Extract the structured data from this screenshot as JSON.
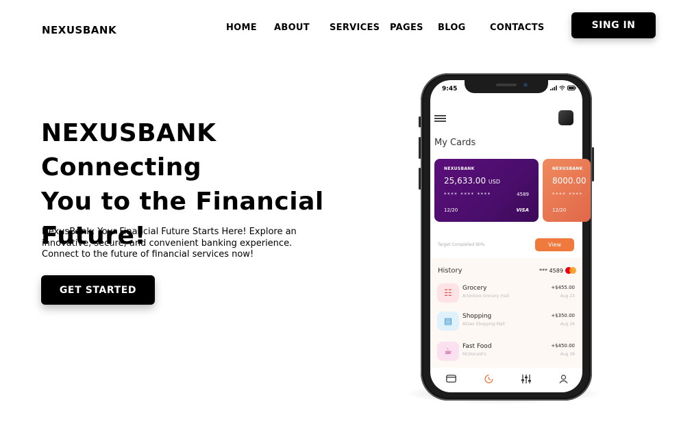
{
  "header": {
    "logo": "NEXUSBANK",
    "nav": [
      "HOME",
      "ABOUT",
      "SERVICES",
      "PAGES",
      "BLOG",
      "CONTACTS"
    ],
    "signin_label": "SING IN"
  },
  "hero": {
    "title_line1": "NEXUSBANK Connecting",
    "title_line2": "You to the Financial",
    "title_line3": "Future!",
    "text_line1": "NexusBank: Your Financial Future Starts Here! Explore an",
    "text_line2": "innovative, secure, and convenient banking experience.",
    "text_line3": "Connect to the future of financial services now!",
    "cta_label": "GET STARTED"
  },
  "phone": {
    "time": "9:45",
    "my_cards_label": "My Cards",
    "cards": [
      {
        "brand": "NEXUSBANK",
        "amount": "25,633.00",
        "currency": "USD",
        "dots": "**** **** ****",
        "last4": "4589",
        "exp": "12/20",
        "network": "VISA"
      },
      {
        "brand": "NEXUSBANK",
        "amount": "8000.00",
        "dots": "**** ****",
        "exp": "12/20"
      }
    ],
    "target_label": "Target Completed 90%",
    "view_label": "View",
    "history_label": "History",
    "history_card": "*** 4589",
    "transactions": [
      {
        "title": "Grocery",
        "sub": "Ariontore Grocery mall",
        "amount": "+$455.00",
        "date": "Aug 23",
        "icon": "grocery-icon"
      },
      {
        "title": "Shopping",
        "sub": "Alizex Shopping Mall",
        "amount": "+$350.00",
        "date": "Aug 26",
        "icon": "shopping-icon"
      },
      {
        "title": "Fast Food",
        "sub": "McDonald's",
        "amount": "+$450.00",
        "date": "Aug 28",
        "icon": "fast-food-icon"
      }
    ],
    "tabs": [
      "wallet-icon",
      "chart-icon",
      "settings-icon",
      "profile-icon"
    ]
  },
  "colors": {
    "accent_orange": "#f07a3e",
    "card_purple": "#5b0f7a",
    "card_orange": "#e0674a",
    "black": "#000000"
  }
}
